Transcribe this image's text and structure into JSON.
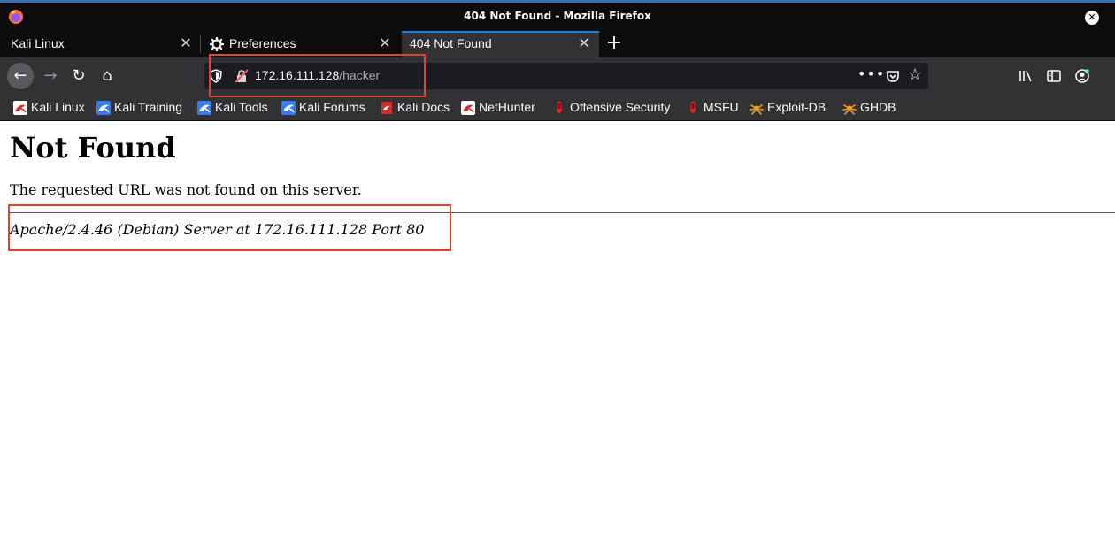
{
  "window": {
    "title": "404 Not Found - Mozilla Firefox",
    "close_glyph": "✕"
  },
  "tabs": [
    {
      "label": "Kali Linux",
      "selected": false
    },
    {
      "label": "Preferences",
      "selected": false,
      "icon": "gear-icon"
    },
    {
      "label": "404 Not Found",
      "selected": true
    }
  ],
  "tab_close_glyph": "✕",
  "new_tab_glyph": "+",
  "navbar": {
    "back_glyph": "←",
    "forward_glyph": "→",
    "reload_glyph": "↻",
    "home_glyph": "⌂",
    "url_host": "172.16.111.128",
    "url_path": "/hacker",
    "more_glyph": "•••",
    "star_glyph": "☆"
  },
  "bookmarks": [
    {
      "label": "Kali Linux",
      "icon": "kali-icon"
    },
    {
      "label": "Kali Training",
      "icon": "kali-icon"
    },
    {
      "label": "Kali Tools",
      "icon": "kali-icon"
    },
    {
      "label": "Kali Forums",
      "icon": "kali-icon"
    },
    {
      "label": "Kali Docs",
      "icon": "kali-docs-icon"
    },
    {
      "label": "NetHunter",
      "icon": "kali-icon"
    },
    {
      "label": "Offensive Security",
      "icon": "offsec-icon"
    },
    {
      "label": "MSFU",
      "icon": "offsec-icon"
    },
    {
      "label": "Exploit-DB",
      "icon": "exploit-db-icon"
    },
    {
      "label": "GHDB",
      "icon": "exploit-db-icon"
    }
  ],
  "page": {
    "heading": "Not Found",
    "message": "The requested URL was not found on this server.",
    "server_signature": "Apache/2.4.46 (Debian) Server at 172.16.111.128 Port 80"
  },
  "colors": {
    "annotation": "#e0442c",
    "tab_accent": "#0a84ff",
    "chrome_dark": "#0c0c0d",
    "chrome_mid": "#323234"
  }
}
